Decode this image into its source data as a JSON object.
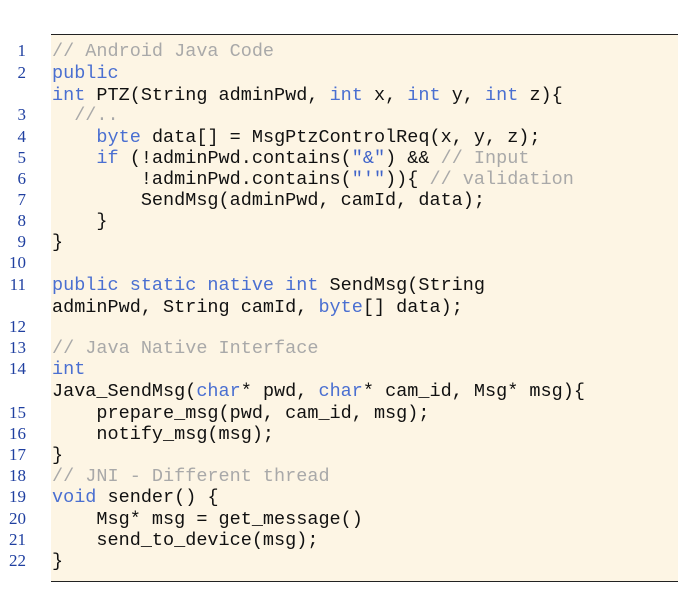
{
  "colors": {
    "background": "#fdf5e4",
    "keyword": "#4a6fd1",
    "comment": "#a9a9a9",
    "line_number": "#1f3fa0",
    "text": "#111111"
  },
  "line_numbers": [
    "1",
    "2",
    "3",
    "4",
    "5",
    "6",
    "7",
    "8",
    "9",
    "10",
    "11",
    "12",
    "13",
    "14",
    "15",
    "16",
    "17",
    "18",
    "19",
    "20",
    "21",
    "22"
  ],
  "code_lines": [
    [
      {
        "t": "// Android Java Code",
        "c": "cm"
      }
    ],
    [
      {
        "t": "public",
        "c": "kw"
      }
    ],
    [
      {
        "t": "int",
        "c": "kw"
      },
      {
        "t": " PTZ(String adminPwd, "
      },
      {
        "t": "int",
        "c": "kw"
      },
      {
        "t": " x, "
      },
      {
        "t": "int",
        "c": "kw"
      },
      {
        "t": " y, "
      },
      {
        "t": "int",
        "c": "kw"
      },
      {
        "t": " z){"
      }
    ],
    [
      {
        "t": "  //..",
        "c": "cm"
      }
    ],
    [
      {
        "t": "    "
      },
      {
        "t": "byte",
        "c": "kw"
      },
      {
        "t": " data[] = MsgPtzControlReq(x, y, z);"
      }
    ],
    [
      {
        "t": "    "
      },
      {
        "t": "if",
        "c": "kw"
      },
      {
        "t": " (!adminPwd.contains("
      },
      {
        "t": "\"&\"",
        "c": "str"
      },
      {
        "t": ") && "
      },
      {
        "t": "// Input",
        "c": "cm"
      }
    ],
    [
      {
        "t": "        !adminPwd.contains("
      },
      {
        "t": "\"'\"",
        "c": "str"
      },
      {
        "t": ")){ "
      },
      {
        "t": "// validation",
        "c": "cm"
      }
    ],
    [
      {
        "t": "        SendMsg(adminPwd, camId, data);"
      }
    ],
    [
      {
        "t": "    }"
      }
    ],
    [
      {
        "t": "}"
      }
    ],
    [
      {
        "t": ""
      }
    ],
    [
      {
        "t": "public static native int",
        "c": "kw"
      },
      {
        "t": " SendMsg(String"
      }
    ],
    [
      {
        "t": "adminPwd, String camId, "
      },
      {
        "t": "byte",
        "c": "kw"
      },
      {
        "t": "[] data);"
      }
    ],
    [
      {
        "t": ""
      }
    ],
    [
      {
        "t": "// Java Native Interface",
        "c": "cm"
      }
    ],
    [
      {
        "t": "int",
        "c": "kw"
      }
    ],
    [
      {
        "t": "Java_SendMsg("
      },
      {
        "t": "char",
        "c": "kw"
      },
      {
        "t": "* pwd, "
      },
      {
        "t": "char",
        "c": "kw"
      },
      {
        "t": "* cam_id, Msg* msg){"
      }
    ],
    [
      {
        "t": "    prepare_msg(pwd, cam_id, msg);"
      }
    ],
    [
      {
        "t": "    notify_msg(msg);"
      }
    ],
    [
      {
        "t": "}"
      }
    ],
    [
      {
        "t": "// JNI - Different thread",
        "c": "cm"
      }
    ],
    [
      {
        "t": "void",
        "c": "kw"
      },
      {
        "t": " sender() {"
      }
    ],
    [
      {
        "t": "    Msg* msg = get_message()"
      }
    ],
    [
      {
        "t": "    send_to_device(msg);"
      }
    ],
    [
      {
        "t": "}"
      }
    ]
  ]
}
